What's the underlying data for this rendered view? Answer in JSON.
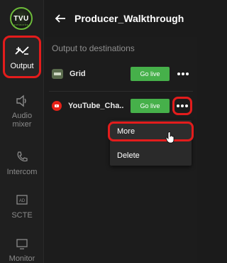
{
  "app": {
    "logo_text": "TVU",
    "logo_sub": "networks"
  },
  "header": {
    "title": "Producer_Walkthrough"
  },
  "sidebar": {
    "items": [
      {
        "label": "Output",
        "icon": "output-icon",
        "active": true
      },
      {
        "label": "Audio\nmixer",
        "icon": "speaker-icon",
        "active": false
      },
      {
        "label": "Intercom",
        "icon": "phone-icon",
        "active": false
      },
      {
        "label": "SCTE",
        "icon": "ad-icon",
        "active": false
      },
      {
        "label": "Monitor",
        "icon": "monitor-icon",
        "active": false
      }
    ]
  },
  "main": {
    "section_title": "Output to destinations",
    "destinations": [
      {
        "name": "Grid",
        "icon": "grid-icon",
        "button": "Go live"
      },
      {
        "name": "YouTube_Cha...",
        "icon": "youtube-icon",
        "button": "Go live"
      }
    ]
  },
  "menu": {
    "items": [
      "More",
      "Delete"
    ]
  },
  "colors": {
    "accent_green": "#46b04a",
    "highlight_red": "#e31c1c",
    "background": "#1b1b1b"
  }
}
